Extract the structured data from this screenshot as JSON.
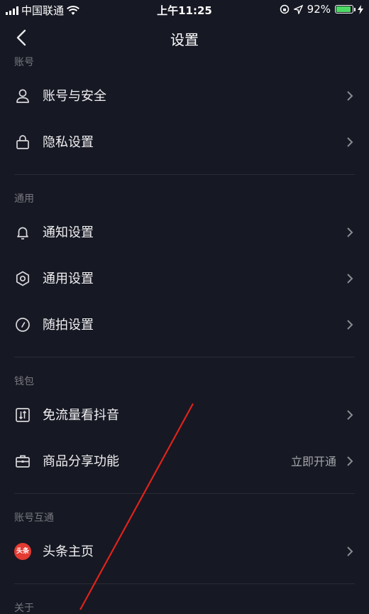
{
  "status_bar": {
    "carrier": "中国联通",
    "time": "上午11:25",
    "battery": "92%"
  },
  "header": {
    "title": "设置"
  },
  "sections": [
    {
      "title": "账号",
      "items": [
        {
          "label": "账号与安全",
          "icon": "person-icon"
        },
        {
          "label": "隐私设置",
          "icon": "lock-icon"
        }
      ]
    },
    {
      "title": "通用",
      "items": [
        {
          "label": "通知设置",
          "icon": "bell-icon"
        },
        {
          "label": "通用设置",
          "icon": "gear-icon"
        },
        {
          "label": "随拍设置",
          "icon": "clock-icon"
        }
      ]
    },
    {
      "title": "钱包",
      "items": [
        {
          "label": "免流量看抖音",
          "icon": "data-icon"
        },
        {
          "label": "商品分享功能",
          "icon": "briefcase-icon",
          "extra": "立即开通"
        }
      ]
    },
    {
      "title": "账号互通",
      "items": [
        {
          "label": "头条主页",
          "icon": "toutiao-logo-icon",
          "logo_text": "头条"
        }
      ]
    },
    {
      "title": "关于"
    }
  ],
  "colors": {
    "background": "#161823",
    "annotation": "#e0231b"
  }
}
